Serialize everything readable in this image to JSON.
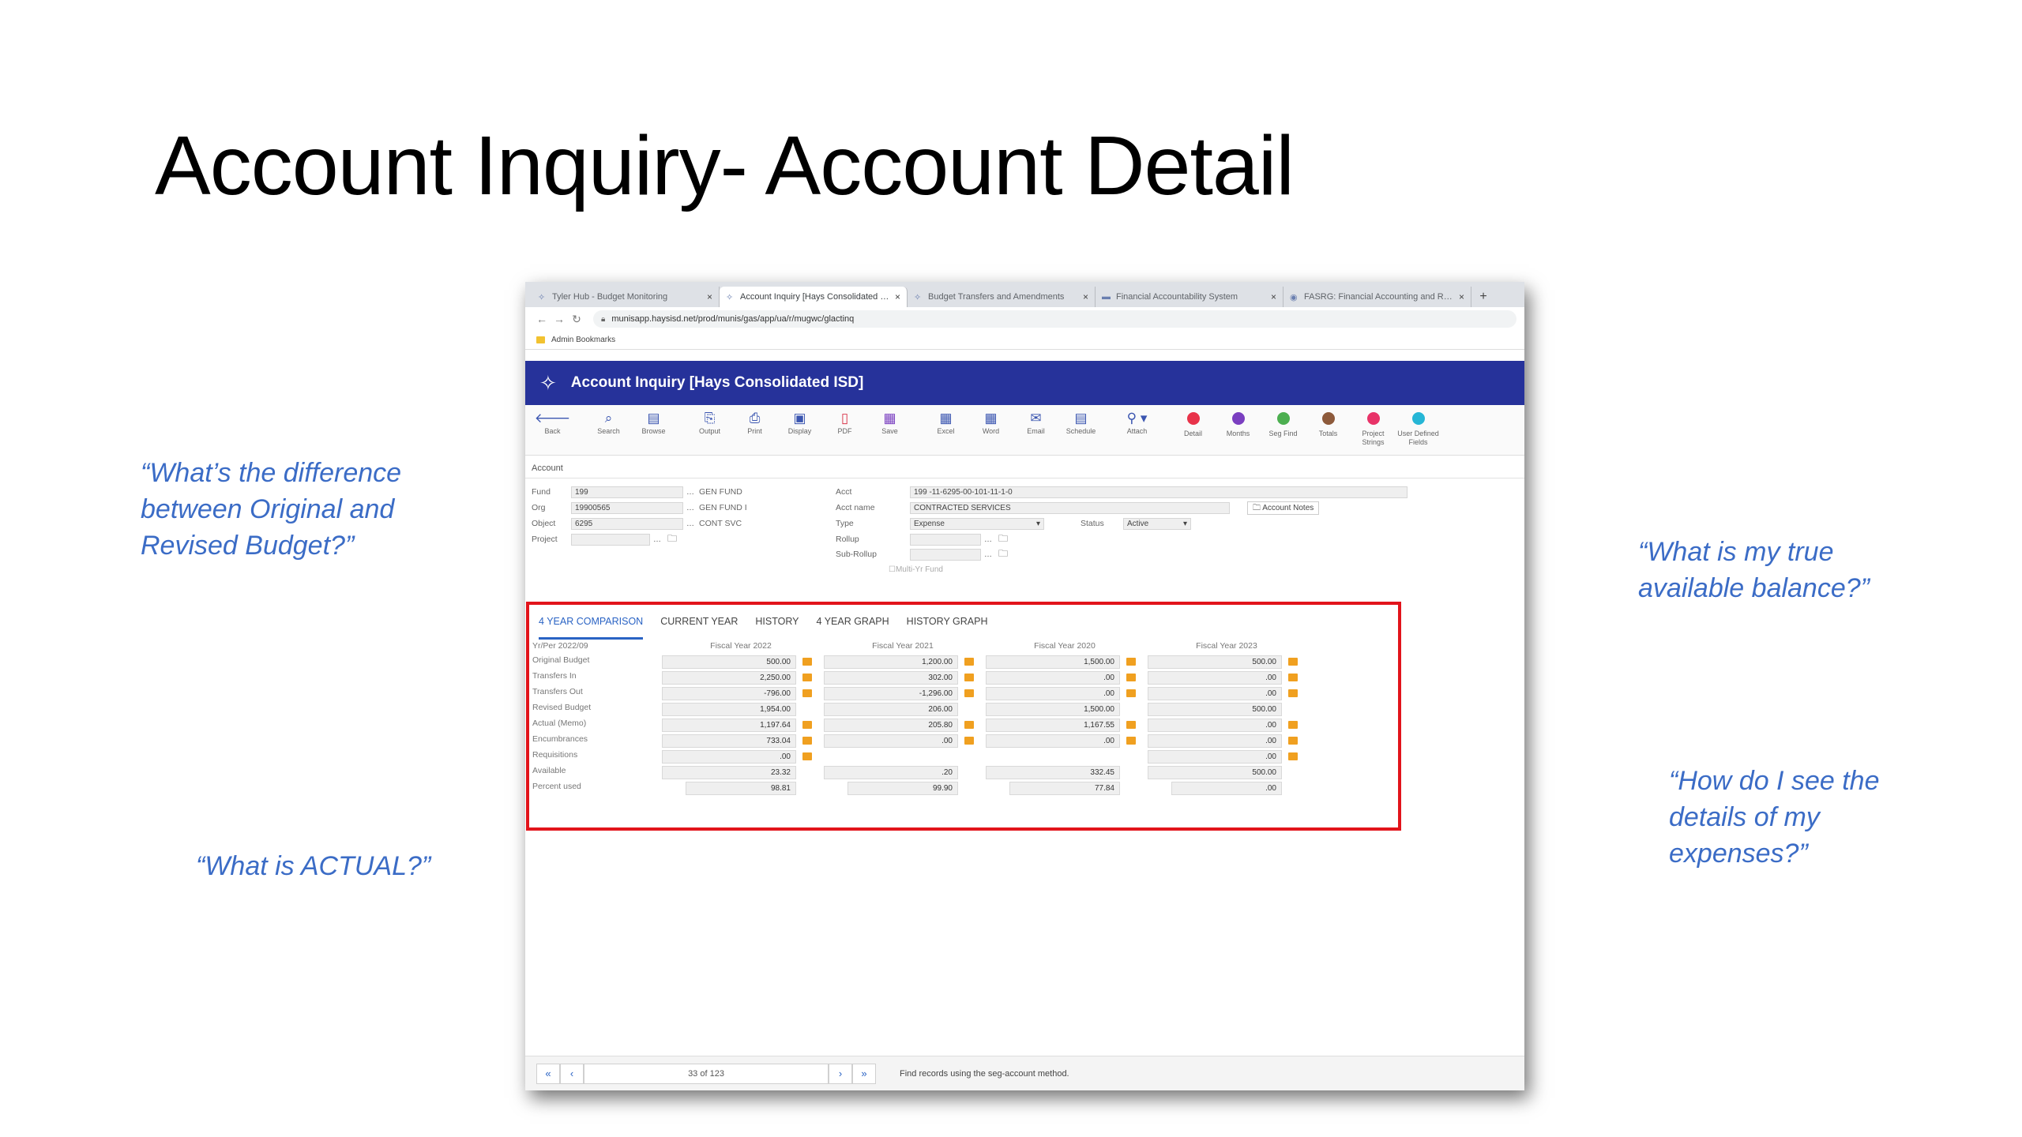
{
  "slide": {
    "title": "Account Inquiry- Account Detail",
    "quotes": {
      "original_revised": "“What’s the difference between Original and Revised Budget?”",
      "available_balance": "“What is my true available balance?”",
      "expense_details": "“How do I see the details of my expenses?”",
      "actual": "“What is ACTUAL?”"
    }
  },
  "browser": {
    "tabs": [
      {
        "label": "Tyler Hub - Budget Monitoring",
        "icon": "tyler-logo-icon"
      },
      {
        "label": "Account Inquiry [Hays Consolidated ISD]",
        "icon": "tyler-logo-icon",
        "active": true
      },
      {
        "label": "Budget Transfers and Amendments",
        "icon": "tyler-logo-icon"
      },
      {
        "label": "Financial Accountability System",
        "icon": "tea-logo-icon"
      },
      {
        "label": "FASRG: Financial Accounting and Reporting",
        "icon": "globe-icon"
      }
    ],
    "url": "munisapp.haysisd.net/prod/munis/gas/app/ua/r/mugwc/glactinq",
    "bookmark_folder": "Admin Bookmarks"
  },
  "app": {
    "title": "Account Inquiry [Hays Consolidated ISD]",
    "toolbar": [
      {
        "label": "Back",
        "icon": "arrow-left-icon"
      },
      {
        "label": "Search",
        "icon": "search-icon"
      },
      {
        "label": "Browse",
        "icon": "browse-icon"
      },
      {
        "label": "Output",
        "icon": "output-icon"
      },
      {
        "label": "Print",
        "icon": "print-icon"
      },
      {
        "label": "Display",
        "icon": "display-icon"
      },
      {
        "label": "PDF",
        "icon": "pdf-icon"
      },
      {
        "label": "Save",
        "icon": "save-icon"
      },
      {
        "label": "Excel",
        "icon": "excel-icon"
      },
      {
        "label": "Word",
        "icon": "word-icon"
      },
      {
        "label": "Email",
        "icon": "email-icon"
      },
      {
        "label": "Schedule",
        "icon": "schedule-icon"
      },
      {
        "label": "Attach",
        "icon": "attach-icon"
      },
      {
        "label": "Detail",
        "icon": "detail-icon",
        "color": "#e8334a"
      },
      {
        "label": "Months",
        "icon": "months-icon",
        "color": "#7a3fc0"
      },
      {
        "label": "Seg Find",
        "icon": "seg-find-icon",
        "color": "#4caf50"
      },
      {
        "label": "Totals",
        "icon": "totals-icon",
        "color": "#8d5a3b"
      },
      {
        "label": "Project Strings",
        "icon": "project-strings-icon",
        "color": "#e83368"
      },
      {
        "label": "User Defined Fields",
        "icon": "user-defined-icon",
        "color": "#26b6d6"
      }
    ],
    "account_section_label": "Account",
    "fields": {
      "fund_label": "Fund",
      "fund": "199",
      "fund_desc": "GEN FUND",
      "org_label": "Org",
      "org": "19900565",
      "org_desc": "GEN FUND I",
      "object_label": "Object",
      "object": "6295",
      "object_desc": "CONT SVC",
      "project_label": "Project",
      "project": "",
      "acct_label": "Acct",
      "acct": "199 -11-6295-00-101-11-1-0",
      "acct_name_label": "Acct name",
      "acct_name": "CONTRACTED SERVICES",
      "type_label": "Type",
      "type": "Expense",
      "status_label": "Status",
      "status": "Active",
      "rollup_label": "Rollup",
      "sub_rollup_label": "Sub-Rollup",
      "multi_yr_label": "Multi-Yr Fund",
      "account_notes_label": "Account Notes"
    },
    "detail_tabs": [
      {
        "label": "4 YEAR COMPARISON",
        "active": true
      },
      {
        "label": "CURRENT YEAR"
      },
      {
        "label": "HISTORY"
      },
      {
        "label": "4 YEAR GRAPH"
      },
      {
        "label": "HISTORY GRAPH"
      }
    ],
    "comparison": {
      "period_label": "Yr/Per 2022/09",
      "years": [
        "Fiscal Year 2022",
        "Fiscal Year 2021",
        "Fiscal Year 2020",
        "Fiscal Year 2023"
      ],
      "row_labels": [
        "Original Budget",
        "Transfers In",
        "Transfers Out",
        "Revised Budget",
        "Actual (Memo)",
        "Encumbrances",
        "Requisitions",
        "Available",
        "Percent used"
      ],
      "values": [
        [
          "500.00",
          "2,250.00",
          "-796.00",
          "1,954.00",
          "1,197.64",
          "733.04",
          ".00",
          "23.32",
          "98.81"
        ],
        [
          "1,200.00",
          "302.00",
          "-1,296.00",
          "206.00",
          "205.80",
          ".00",
          "",
          ".20",
          "99.90"
        ],
        [
          "1,500.00",
          ".00",
          ".00",
          "1,500.00",
          "1,167.55",
          ".00",
          "",
          "332.45",
          "77.84"
        ],
        [
          "500.00",
          ".00",
          ".00",
          "500.00",
          ".00",
          ".00",
          ".00",
          "500.00",
          ".00"
        ]
      ]
    },
    "pager": {
      "record": "33 of 123",
      "message": "Find records using the seg-account method."
    }
  },
  "colors": {
    "header": "#26329a",
    "highlight": "#e2141b",
    "quote": "#3b6cc6",
    "active_tab": "#2a63c4"
  }
}
